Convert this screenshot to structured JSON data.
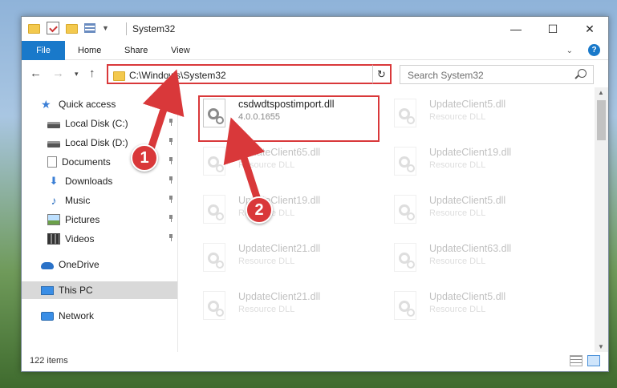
{
  "window": {
    "title": "System32",
    "controls": {
      "minimize": "—",
      "maximize": "☐",
      "close": "✕"
    }
  },
  "ribbon": {
    "tabs": [
      {
        "label": "File"
      },
      {
        "label": "Home"
      },
      {
        "label": "Share"
      },
      {
        "label": "View"
      }
    ],
    "help": "?"
  },
  "navbar": {
    "address": "C:\\Windows\\System32",
    "search_placeholder": "Search System32"
  },
  "sidebar": {
    "items": [
      {
        "label": "Quick access"
      },
      {
        "label": "Local Disk (C:)"
      },
      {
        "label": "Local Disk (D:)"
      },
      {
        "label": "Documents"
      },
      {
        "label": "Downloads"
      },
      {
        "label": "Music"
      },
      {
        "label": "Pictures"
      },
      {
        "label": "Videos"
      },
      {
        "label": "OneDrive"
      },
      {
        "label": "This PC"
      },
      {
        "label": "Network"
      }
    ]
  },
  "files": [
    {
      "name": "csdwdtspostimport.dll",
      "desc": "4.0.0.1655"
    },
    {
      "name": "UpdateClient5.dll",
      "desc": "Resource DLL"
    },
    {
      "name": "UpdateClient65.dll",
      "desc": "Resource DLL"
    },
    {
      "name": "UpdateClient19.dll",
      "desc": "Resource DLL"
    },
    {
      "name": "UpdateClient19.dll",
      "desc": "Resource DLL"
    },
    {
      "name": "UpdateClient5.dll",
      "desc": "Resource DLL"
    },
    {
      "name": "UpdateClient21.dll",
      "desc": "Resource DLL"
    },
    {
      "name": "UpdateClient63.dll",
      "desc": "Resource DLL"
    },
    {
      "name": "UpdateClient21.dll",
      "desc": "Resource DLL"
    },
    {
      "name": "UpdateClient5.dll",
      "desc": "Resource DLL"
    }
  ],
  "status": {
    "count": "122 items"
  },
  "callouts": {
    "one": "1",
    "two": "2"
  },
  "colors": {
    "accent": "#1979ca",
    "callout": "#d9383a"
  }
}
